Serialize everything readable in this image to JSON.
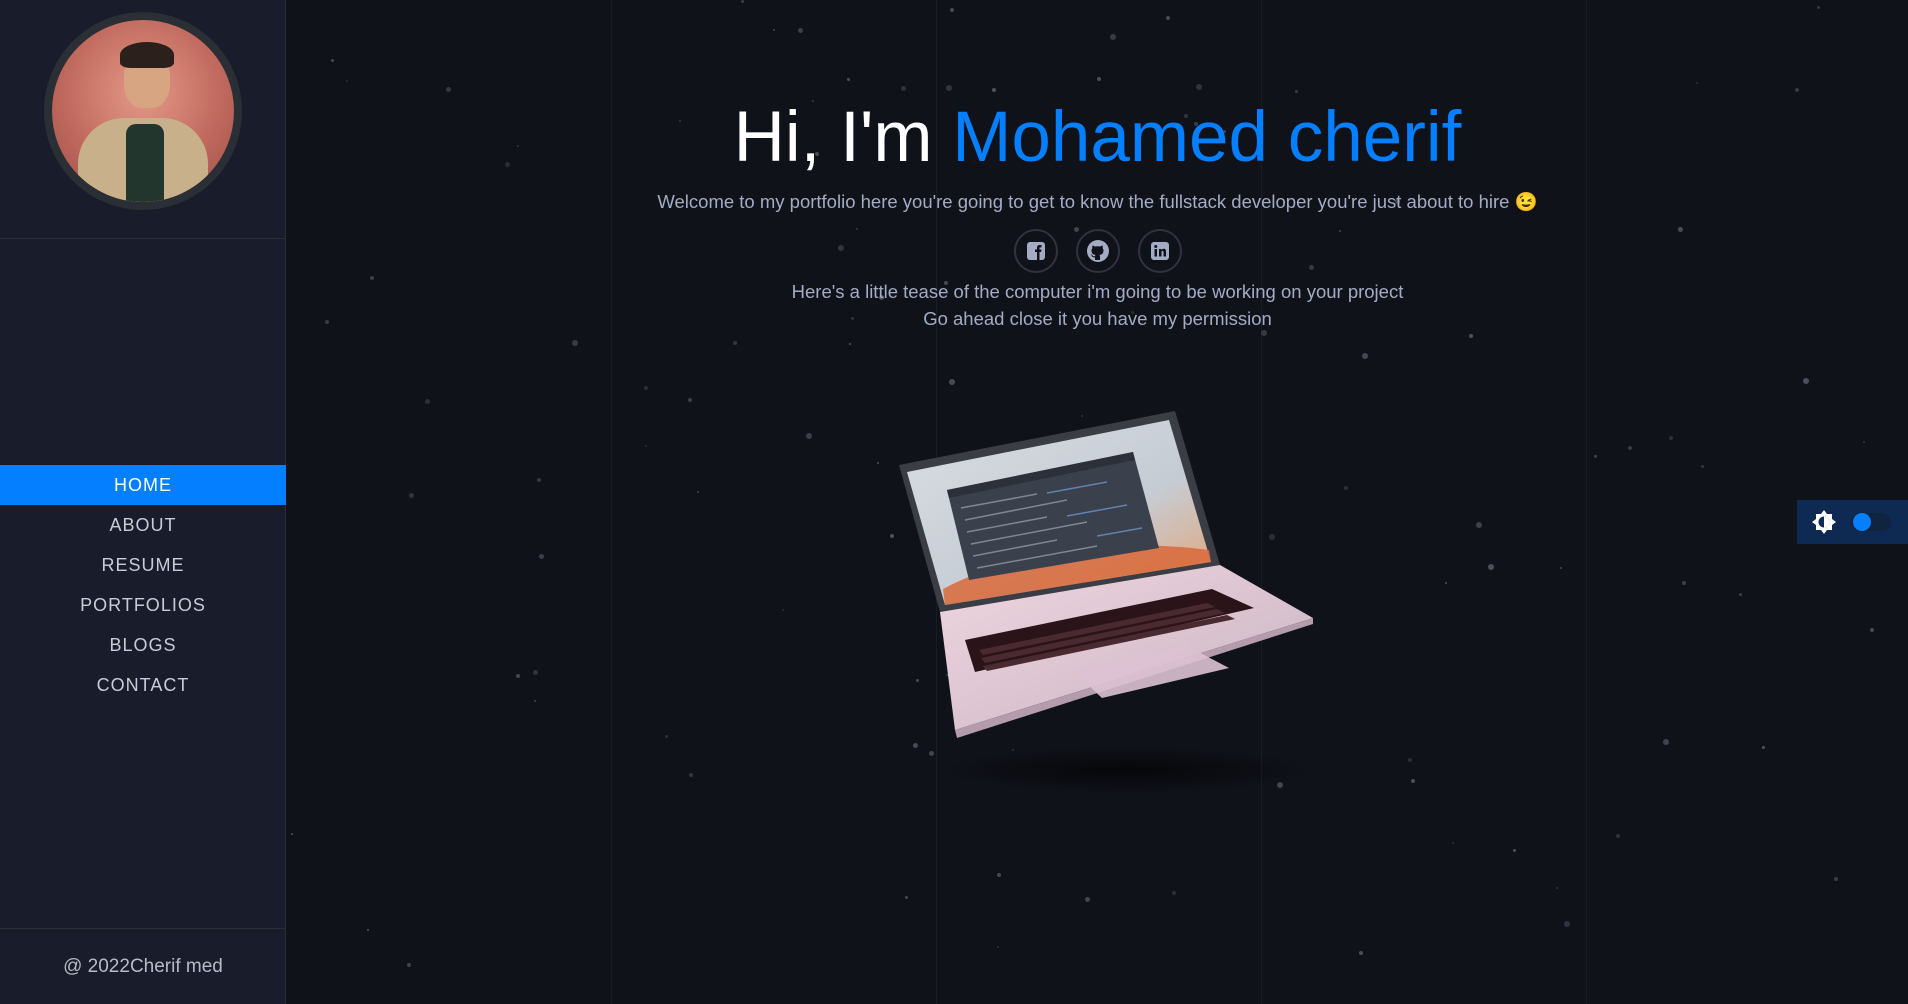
{
  "sidebar": {
    "nav": [
      {
        "label": "HOME",
        "active": true
      },
      {
        "label": "ABOUT"
      },
      {
        "label": "RESUME"
      },
      {
        "label": "PORTFOLIOS"
      },
      {
        "label": "BLOGS"
      },
      {
        "label": "CONTACT"
      }
    ],
    "copyright": "@ 2022Cherif med"
  },
  "hero": {
    "greeting": "Hi, I'm ",
    "name": "Mohamed cherif",
    "welcome": "Welcome to my portfolio here you're going to get to know the fullstack developer you're just about to hire 😉",
    "socials": [
      {
        "icon": "facebook-icon"
      },
      {
        "icon": "github-icon"
      },
      {
        "icon": "linkedin-icon"
      }
    ],
    "tease_line1": "Here's a little tease of the computer i'm going to be working on your project",
    "tease_line2": "Go ahead close it you have my permission"
  },
  "theme_switch": {
    "icon": "brightness-icon",
    "mode": "dark"
  },
  "colors": {
    "accent": "#037fff",
    "background": "#10121a",
    "sidebar": "#191d2b",
    "text_muted": "#a4acc4"
  }
}
